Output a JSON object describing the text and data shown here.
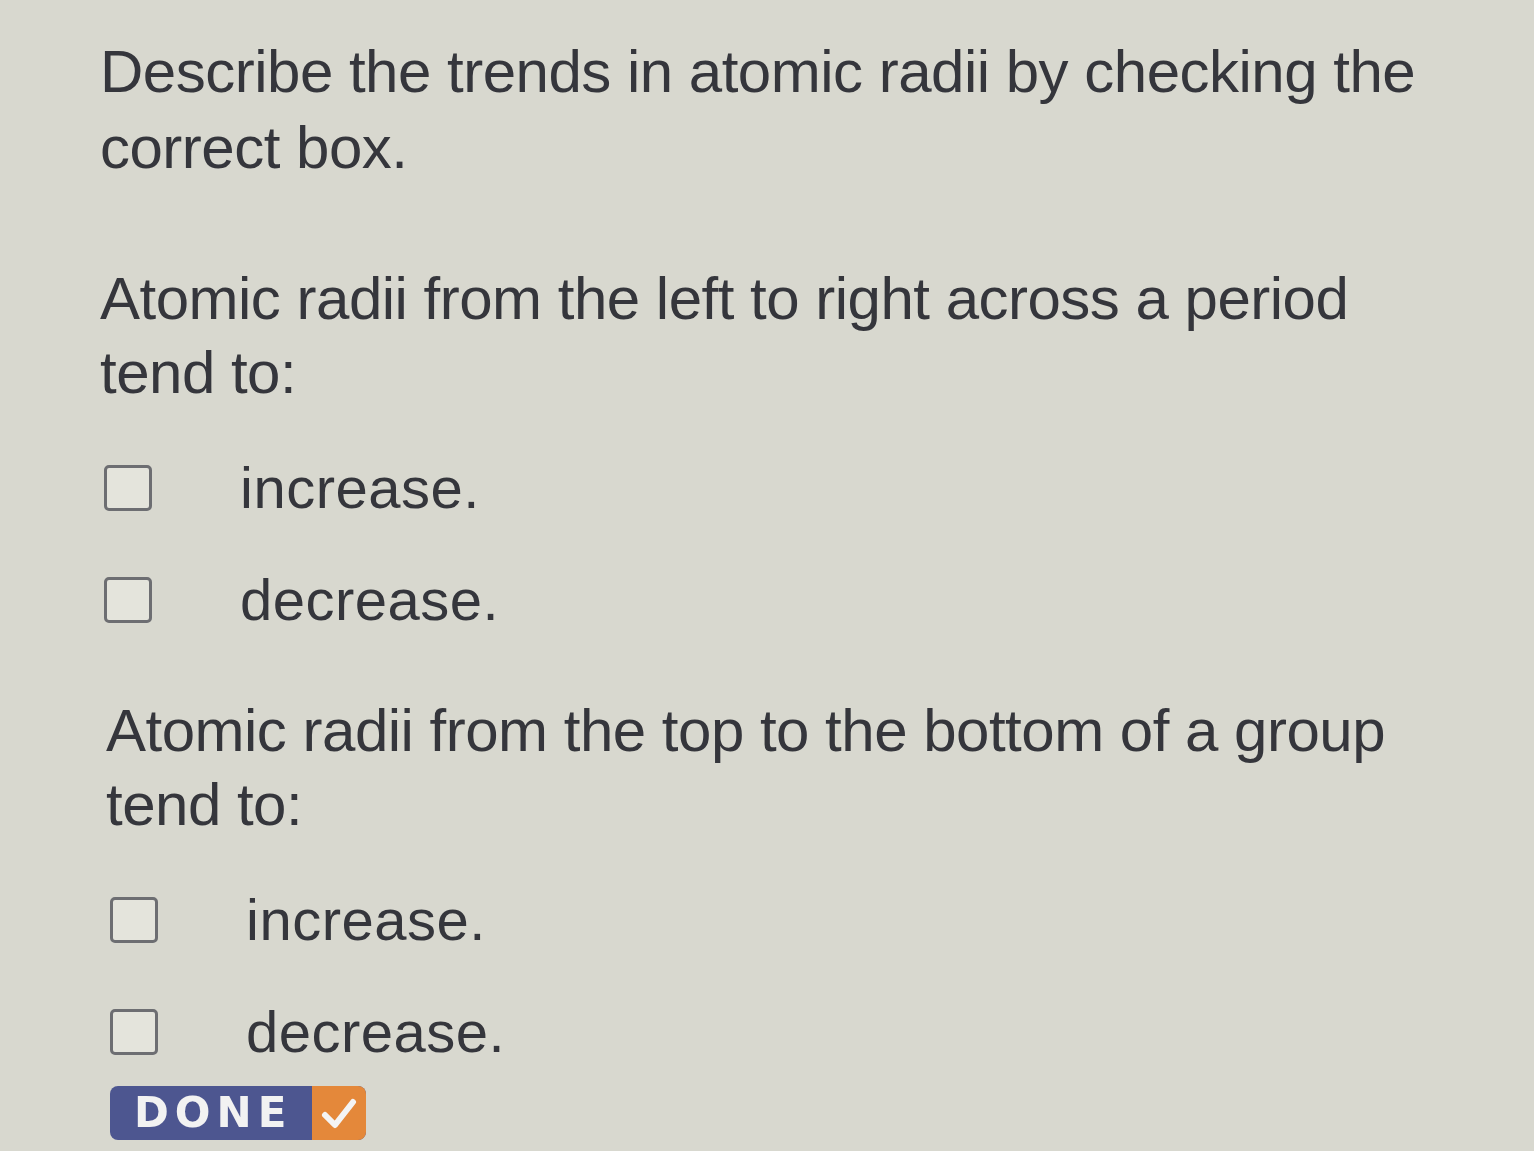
{
  "instruction": "Describe the trends in atomic radii by checking the correct box.",
  "questions": [
    {
      "prompt": "Atomic radii from the left to right across a period tend to:",
      "options": [
        {
          "label": "increase.",
          "checked": false
        },
        {
          "label": "decrease.",
          "checked": false
        }
      ]
    },
    {
      "prompt": "Atomic radii from the top to the bottom of a group tend to:",
      "options": [
        {
          "label": "increase.",
          "checked": false
        },
        {
          "label": "decrease.",
          "checked": false
        }
      ]
    }
  ],
  "done_button": {
    "label": "DONE"
  }
}
